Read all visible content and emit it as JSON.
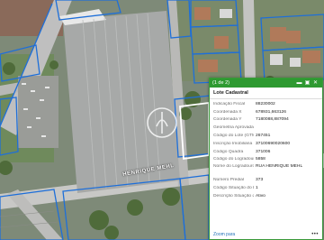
{
  "popup": {
    "counter": "(1 de 2)",
    "title": "Lote Cadastral",
    "fields": [
      {
        "key": "Indicação Fiscal",
        "value": "88230002"
      },
      {
        "key": "Coordenada X",
        "value": "678931,663126"
      },
      {
        "key": "Coordenada Y",
        "value": "7180088,887094"
      },
      {
        "key": "Geometria Aprovada",
        "value": ""
      },
      {
        "key": "Código do Lote (GTM)",
        "value": "267451"
      },
      {
        "key": "Inscrição Imobiliária",
        "value": "37100690020600"
      },
      {
        "key": "Código Quadra",
        "value": "371006"
      },
      {
        "key": "Código do Logradouro",
        "value": "5858"
      },
      {
        "key": "Nome do Logradouro",
        "value": "RUA HENRIQUE MEHL"
      },
      {
        "key": "Número Predial",
        "value": "373"
      },
      {
        "key": "Código Situação do Lote",
        "value": "1"
      },
      {
        "key": "Descrição Situação do Lote",
        "value": "Ativo"
      }
    ],
    "zoom_link": "Zoom para",
    "more": "•••"
  },
  "map": {
    "road_label": "HENRIQUE MEHL"
  },
  "colors": {
    "popup_header": "#2e9a31",
    "parcel_outline": "#1e6fd9",
    "selected_parcel": "#ffffff"
  },
  "icons": [
    "minimize-icon",
    "expand-icon",
    "close-icon",
    "more-icon",
    "watermark-logo"
  ]
}
